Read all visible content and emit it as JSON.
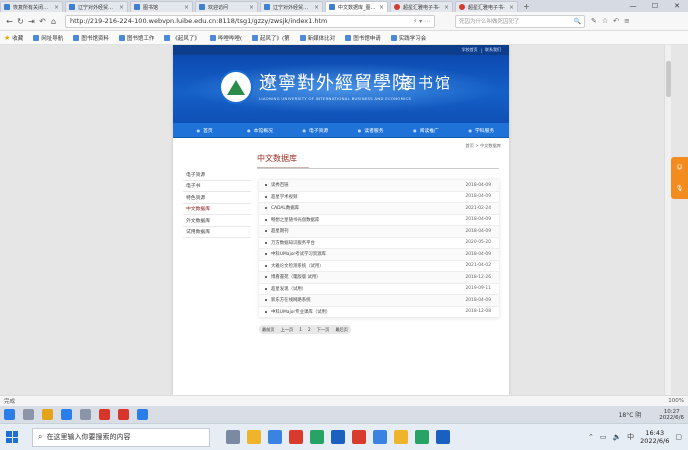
{
  "tabs": [
    {
      "label": "恢复所有关闭页面",
      "active": false,
      "icon": "page-icon"
    },
    {
      "label": "辽宁对外经贸学院",
      "active": false,
      "icon": "page-icon"
    },
    {
      "label": "图书馆",
      "active": false,
      "icon": "page-icon"
    },
    {
      "label": "欢迎访问",
      "active": false,
      "icon": "page-icon"
    },
    {
      "label": "辽宁对外经贸学院",
      "active": false,
      "icon": "page-icon"
    },
    {
      "label": "中文数据库_图书馆",
      "active": true,
      "icon": "page-icon"
    },
    {
      "label": "超星汇雅电子书-",
      "active": false,
      "icon": "superstar-icon"
    },
    {
      "label": "超星汇雅电子书-",
      "active": false,
      "icon": "superstar-icon"
    }
  ],
  "address": {
    "url": "http://219-216-224-100.webvpn.luibe.edu.cn:8118/tsg1/gzzy/zwsjk/index1.htm",
    "search_placeholder": "死囚为什么叫做死囚犯了"
  },
  "bookmarks": [
    "收藏",
    "网址导航",
    "图书馆资料",
    "图书馆工作",
    "《起风了》",
    "哔哩哔哩(",
    "起风了》(第",
    "新媒体比对",
    "图书馆申请",
    "实践学习会"
  ],
  "site": {
    "top_links": [
      "学校首页",
      "联系我们"
    ],
    "school_name": "遼寧對外經貿學院",
    "library": "图书馆",
    "english_name": "LIAONING UNIVERSITY OF INTERNATIONAL BUSINESS AND ECONOMICS",
    "nav": [
      "首页",
      "本馆概况",
      "电子资源",
      "读者服务",
      "阅读推广",
      "学科服务"
    ],
    "breadcrumb": "首页 > 中文数据库"
  },
  "sidebar": [
    {
      "label": "电子资源",
      "current": false
    },
    {
      "label": "电子书",
      "current": false
    },
    {
      "label": "特色资源",
      "current": false
    },
    {
      "label": "中文数据库",
      "current": true
    },
    {
      "label": "外文数据库",
      "current": false
    },
    {
      "label": "试用数据库",
      "current": false
    }
  ],
  "content": {
    "title": "中文数据库",
    "rows": [
      {
        "title": "读秀百链",
        "date": "2018-04-09"
      },
      {
        "title": "超星学术视频",
        "date": "2018-04-09"
      },
      {
        "title": "CADAL数据库",
        "date": "2021-02-24"
      },
      {
        "title": "畅想之星随书光盘数据库",
        "date": "2018-04-09"
      },
      {
        "title": "超星期刊",
        "date": "2018-04-09"
      },
      {
        "title": "万方数据知识服务平台",
        "date": "2020-05-20"
      },
      {
        "title": "中科UMajor考试学习资源库",
        "date": "2018-04-09"
      },
      {
        "title": "大雅论文检测系统（试用）",
        "date": "2021-04-02"
      },
      {
        "title": "博看書苑（電版版 试用）",
        "date": "2018-12-26"
      },
      {
        "title": "超星发现（试用）",
        "date": "2019-09-11"
      },
      {
        "title": "新东方在线网路系统",
        "date": "2018-04-09"
      },
      {
        "title": "中科UMajor专业课库（试用）",
        "date": "2018-12-08"
      }
    ],
    "pager": [
      "最前页",
      "上一页",
      "1",
      "2",
      "下一页",
      "最后页"
    ]
  },
  "status": {
    "text": "完成",
    "zoom": "100%"
  },
  "midbar": {
    "weather": "18°C 阴",
    "time": "10:27",
    "date": "2022/6/6"
  },
  "taskbar": {
    "search_placeholder": "在这里输入你要搜索的内容",
    "time": "16:43",
    "date": "2022/6/6"
  }
}
